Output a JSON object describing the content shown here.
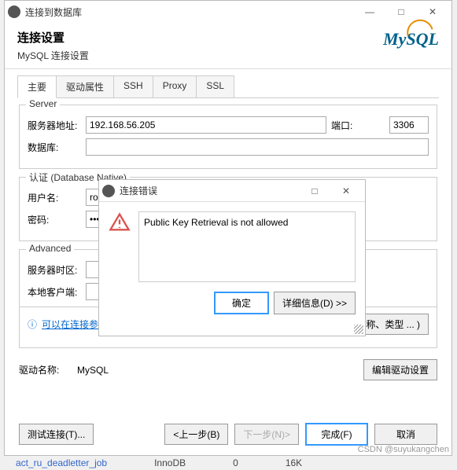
{
  "titlebar": {
    "title": "连接到数据库"
  },
  "header": {
    "title": "连接设置",
    "subtitle": "MySQL 连接设置",
    "logo": "MySQL"
  },
  "tabs": [
    "主要",
    "驱动属性",
    "SSH",
    "Proxy",
    "SSL"
  ],
  "server": {
    "legend": "Server",
    "host_label": "服务器地址:",
    "host": "192.168.56.205",
    "port_label": "端口:",
    "port": "3306",
    "db_label": "数据库:",
    "db": ""
  },
  "auth": {
    "legend": "认证 (Database Native)",
    "user_label": "用户名:",
    "user": "root",
    "pass_label": "密码:",
    "pass": "••••••"
  },
  "advanced": {
    "legend": "Advanced",
    "tz_label": "服务器时区:",
    "tz": "",
    "local_label": "本地客户端:",
    "local": ""
  },
  "link_text": "可以在连接参数中使用变量。",
  "edit_btn": "名称、类型 ... )",
  "driver": {
    "label": "驱动名称:",
    "value": "MySQL",
    "edit_btn": "编辑驱动设置"
  },
  "footer": {
    "test": "测试连接(T)...",
    "back": "<上一步(B)",
    "next": "下一步(N)>",
    "finish": "完成(F)",
    "cancel": "取消"
  },
  "modal": {
    "title": "连接错误",
    "message": "Public Key Retrieval is not allowed",
    "ok": "确定",
    "details": "详细信息(D) >>"
  },
  "bg": {
    "name": "act_ru_deadletter_job",
    "engine": "InnoDB",
    "c1": "0",
    "c2": "16K"
  },
  "watermark": "CSDN @suyukangchen"
}
